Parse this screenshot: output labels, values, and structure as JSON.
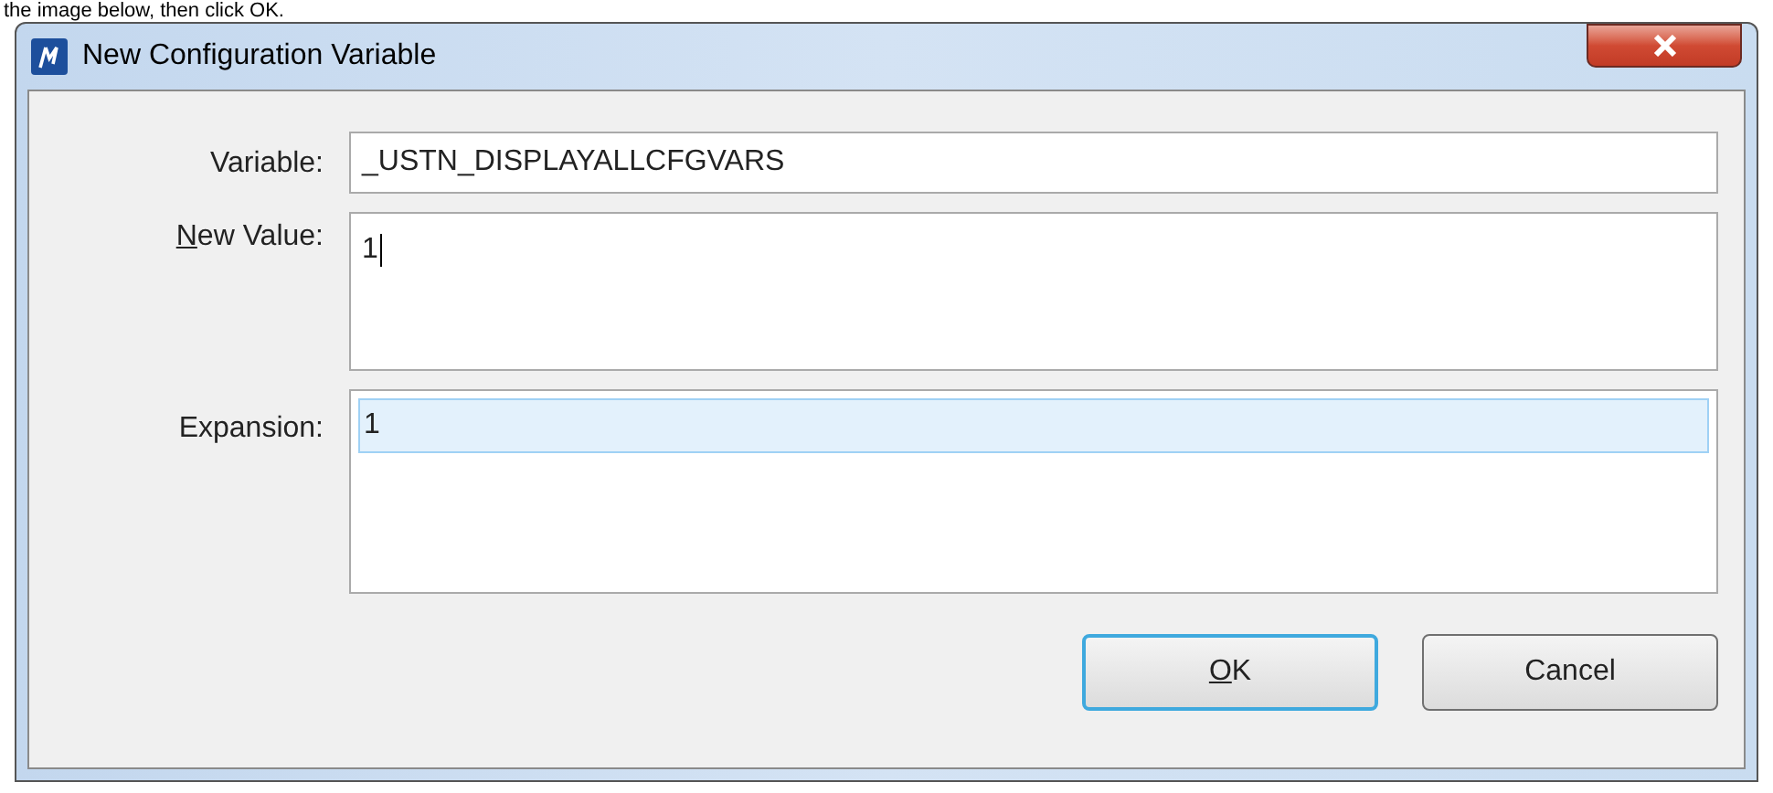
{
  "caption": "the image below, then click OK.",
  "window": {
    "title": "New Configuration Variable"
  },
  "fields": [
    {
      "kind": "line",
      "label": "Variable:",
      "underline_first_letter": false,
      "value": "_USTN_DISPLAYALLCFGVARS",
      "focused": false,
      "highlighted": false
    },
    {
      "kind": "area",
      "label": "New Value:",
      "underline_first_letter": true,
      "value": "1",
      "focused": true,
      "highlighted": false
    },
    {
      "kind": "list",
      "label": "Expansion:",
      "underline_first_letter": false,
      "value": "1",
      "focused": false,
      "highlighted": true
    }
  ],
  "buttons": [
    {
      "label": "OK",
      "default": true,
      "underline_first_letter": true
    },
    {
      "label": "Cancel",
      "default": false,
      "underline_first_letter": false
    }
  ]
}
